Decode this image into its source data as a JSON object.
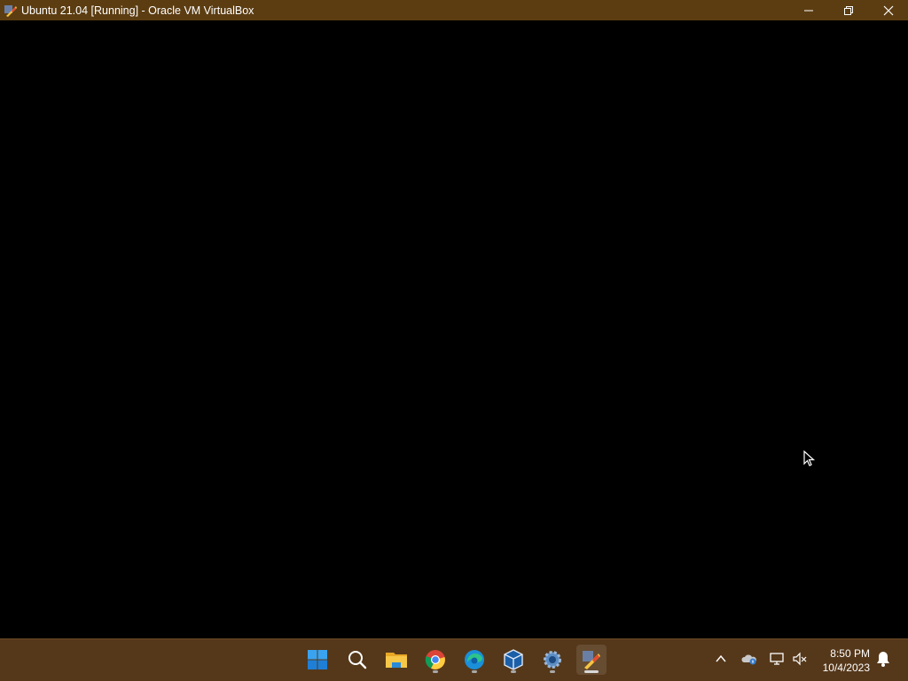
{
  "window": {
    "title": "Ubuntu 21.04 [Running] - Oracle VM VirtualBox",
    "titlebar_color": "#5c3d12"
  },
  "taskbar": {
    "color": "#55381a",
    "apps": [
      {
        "name": "start-icon"
      },
      {
        "name": "search-icon"
      },
      {
        "name": "file-explorer-icon"
      },
      {
        "name": "chrome-icon",
        "running": true
      },
      {
        "name": "edge-icon",
        "running": true
      },
      {
        "name": "virtualbox-icon",
        "running": true
      },
      {
        "name": "settings-icon",
        "running": true
      },
      {
        "name": "virtualbox-vm-icon",
        "running": true,
        "active": true
      }
    ],
    "tray": {
      "icons": [
        "chevron-up-icon",
        "onedrive-icon",
        "network-icon",
        "volume-muted-icon",
        "notification-bell-icon"
      ],
      "time": "8:50 PM",
      "date": "10/4/2023"
    }
  }
}
